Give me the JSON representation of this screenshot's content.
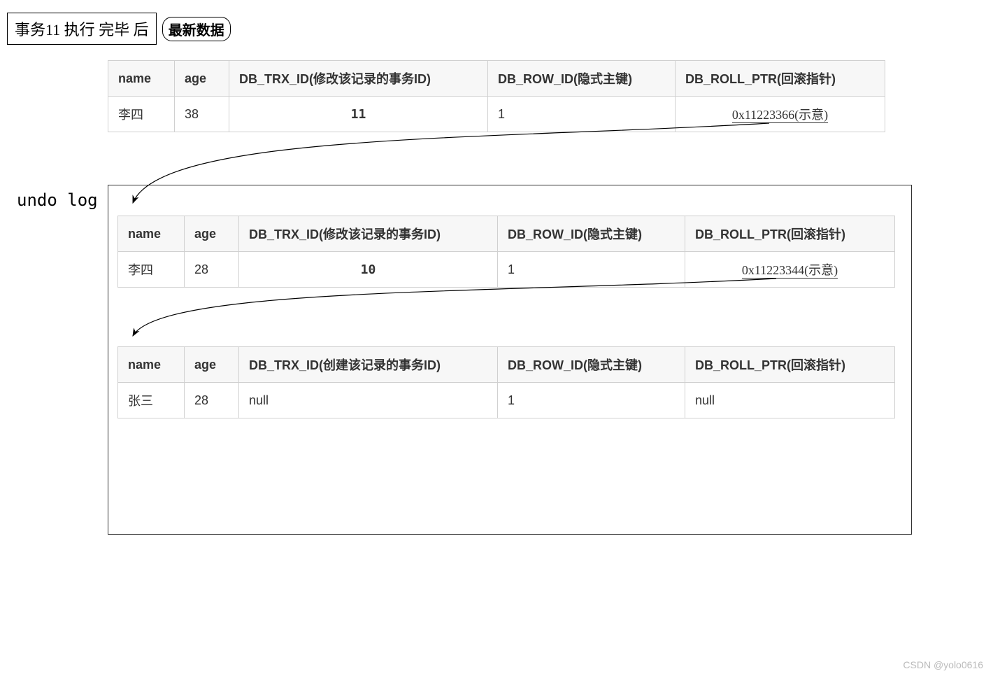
{
  "title": {
    "boxed": "事务11 执行 完毕 后",
    "oval": "最新数据"
  },
  "undo_label": "undo log",
  "tables": {
    "t1": {
      "headers": {
        "name": "name",
        "age": "age",
        "trx": "DB_TRX_ID(修改该记录的事务ID)",
        "rowid": "DB_ROW_ID(隐式主键)",
        "ptr": "DB_ROLL_PTR(回滚指针)"
      },
      "row": {
        "name": "李四",
        "age": "38",
        "trx": "11",
        "rowid": "1",
        "ptr": "0x11223366(示意)"
      }
    },
    "t2": {
      "headers": {
        "name": "name",
        "age": "age",
        "trx": "DB_TRX_ID(修改该记录的事务ID)",
        "rowid": "DB_ROW_ID(隐式主键)",
        "ptr": "DB_ROLL_PTR(回滚指针)"
      },
      "row": {
        "name": "李四",
        "age": "28",
        "trx": "10",
        "rowid": "1",
        "ptr": "0x11223344(示意)"
      }
    },
    "t3": {
      "headers": {
        "name": "name",
        "age": "age",
        "trx": "DB_TRX_ID(创建该记录的事务ID)",
        "rowid": "DB_ROW_ID(隐式主键)",
        "ptr": "DB_ROLL_PTR(回滚指针)"
      },
      "row": {
        "name": "张三",
        "age": "28",
        "trx": "null",
        "rowid": "1",
        "ptr": "null"
      }
    }
  },
  "watermark": "CSDN @yolo0616"
}
